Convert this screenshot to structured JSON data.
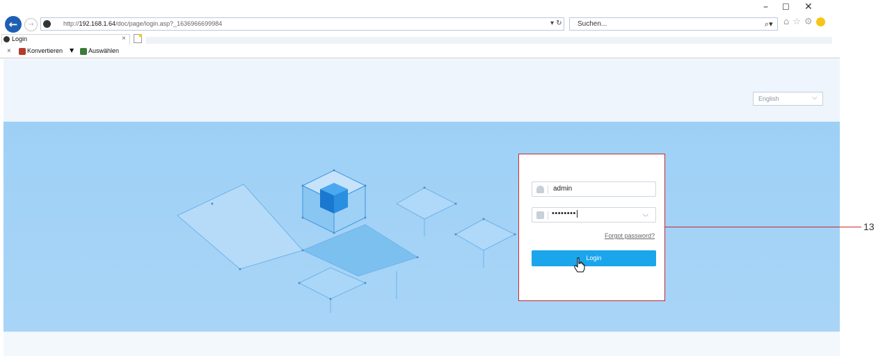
{
  "browser": {
    "window_controls": {
      "minimize": "–",
      "maximize": "☐",
      "close": "✕"
    },
    "url_prefix": "http://",
    "url_host": "192.168.1.64",
    "url_path": "/doc/page/login.asp?_1636966699984",
    "search_placeholder": "Suchen...",
    "tab_title": "Login",
    "tab_close": "×",
    "favorites": {
      "close": "×",
      "konvertieren": "Konvertieren",
      "dropdown": "▼",
      "auswaehlen": "Auswählen"
    },
    "icons": [
      "back-arrow-icon",
      "forward-arrow-icon",
      "search-icon",
      "home-icon",
      "star-icon",
      "gear-icon",
      "smiley-icon"
    ]
  },
  "page": {
    "language": "English",
    "login": {
      "username": "admin",
      "password_mask": "••••••••",
      "forgot_password": "Forgot password?",
      "login_button": "Login"
    }
  },
  "annotation": {
    "label": "13",
    "color": "#c72a2a"
  },
  "colors": {
    "banner": "#a3d3f7",
    "login_button": "#1ba6ec",
    "cube": "#2b8fe0"
  }
}
